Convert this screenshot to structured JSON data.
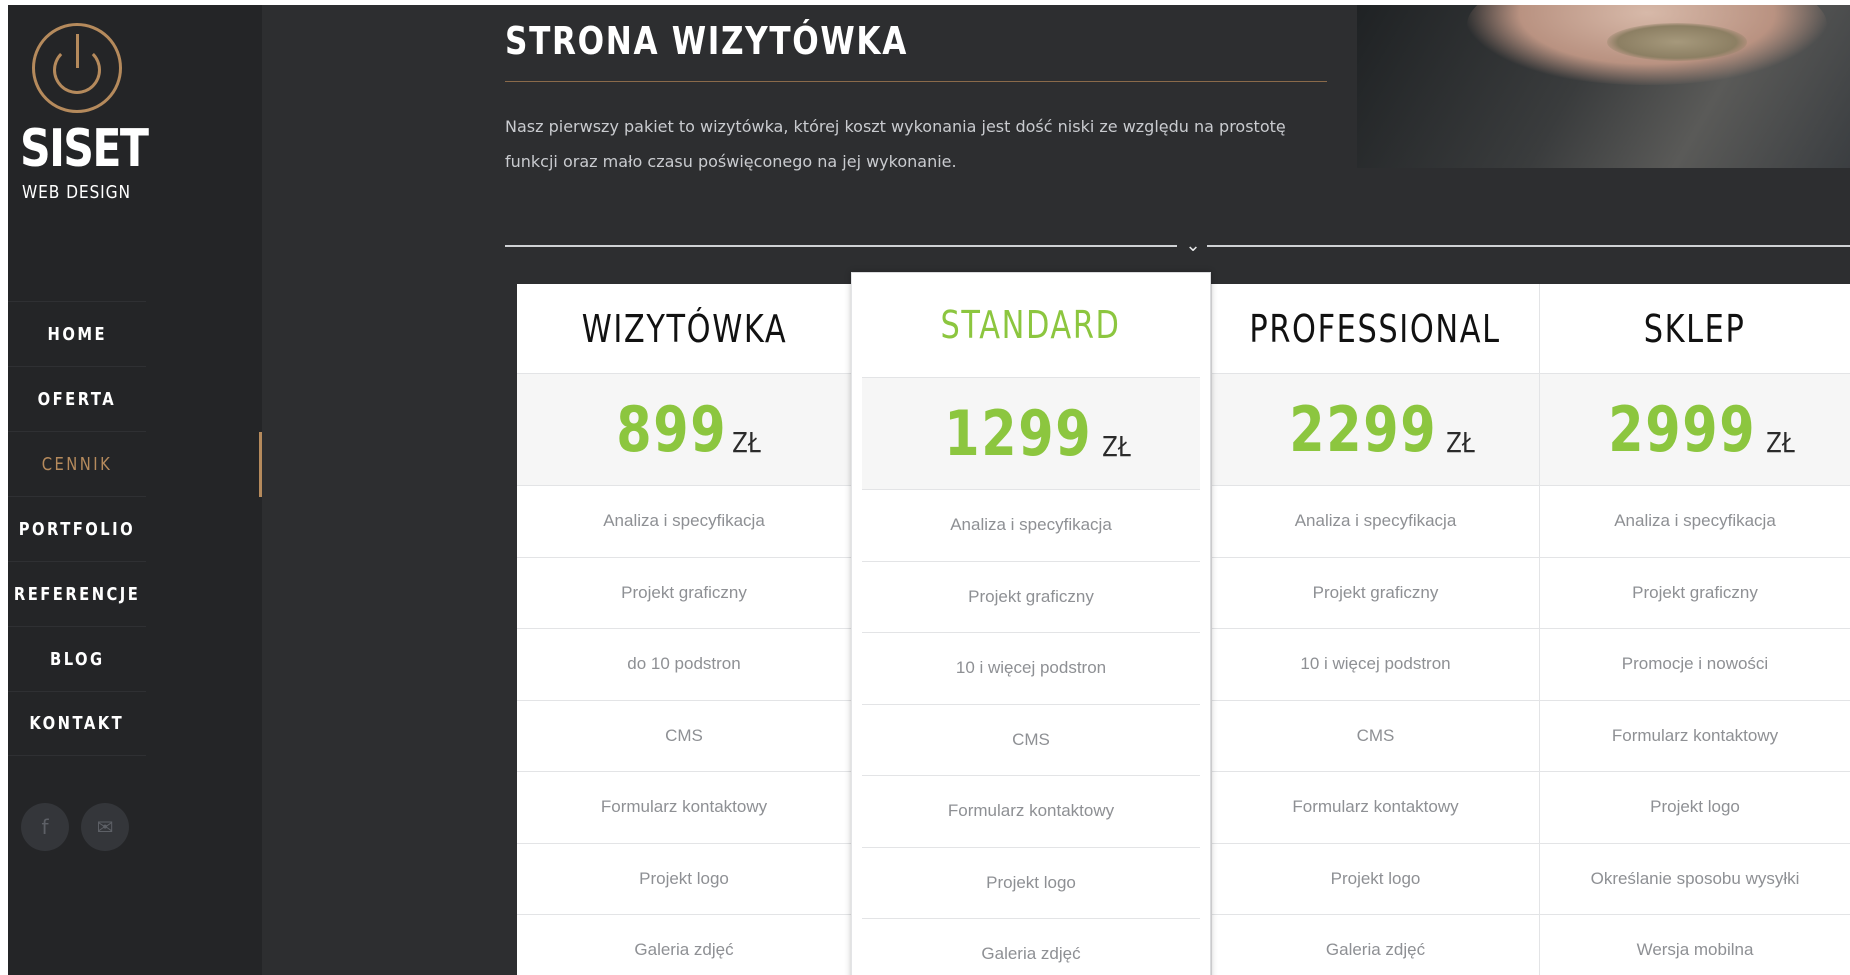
{
  "sidebar": {
    "brand": "SISET",
    "brand_sub": "WEB DESIGN",
    "nav": [
      {
        "label": "HOME"
      },
      {
        "label": "OFERTA"
      },
      {
        "label": "CENNIK",
        "active": true
      },
      {
        "label": "PORTFOLIO"
      },
      {
        "label": "REFERENCJE"
      },
      {
        "label": "BLOG"
      },
      {
        "label": "KONTAKT"
      }
    ],
    "socials": [
      {
        "icon": "facebook-icon",
        "glyph": "f"
      },
      {
        "icon": "mail-icon",
        "glyph": "✉"
      }
    ]
  },
  "section": {
    "title": "STRONA WIZYTÓWKA",
    "intro": "Nasz pierwszy pakiet to wizytówka, której koszt wykonania jest dość niski ze względu na prostotę funkcji oraz mało czasu poświęconego na jej wykonanie.",
    "divider_icon": "chevron-down-icon",
    "divider_glyph": "⌄"
  },
  "pricing": {
    "currency": "ZŁ",
    "accent_color": "#8cc63f",
    "plans": [
      {
        "name": "WIZYTÓWKA",
        "price": "899",
        "featured": false,
        "features": [
          "Analiza i specyfikacja",
          "Projekt graficzny",
          "do 10 podstron",
          "CMS",
          "Formularz kontaktowy",
          "Projekt logo",
          "Galeria zdjęć"
        ]
      },
      {
        "name": "STANDARD",
        "price": "1299",
        "featured": true,
        "features": [
          "Analiza i specyfikacja",
          "Projekt graficzny",
          "10 i więcej podstron",
          "CMS",
          "Formularz kontaktowy",
          "Projekt logo",
          "Galeria zdjęć"
        ]
      },
      {
        "name": "PROFESSIONAL",
        "price": "2299",
        "featured": false,
        "features": [
          "Analiza i specyfikacja",
          "Projekt graficzny",
          "10 i więcej podstron",
          "CMS",
          "Formularz kontaktowy",
          "Projekt logo",
          "Galeria zdjęć"
        ]
      },
      {
        "name": "SKLEP",
        "price": "2999",
        "featured": false,
        "features": [
          "Analiza i specyfikacja",
          "Projekt graficzny",
          "Promocje i nowości",
          "Formularz kontaktowy",
          "Projekt logo",
          "Określanie sposobu wysyłki",
          "Wersja mobilna"
        ]
      }
    ]
  }
}
